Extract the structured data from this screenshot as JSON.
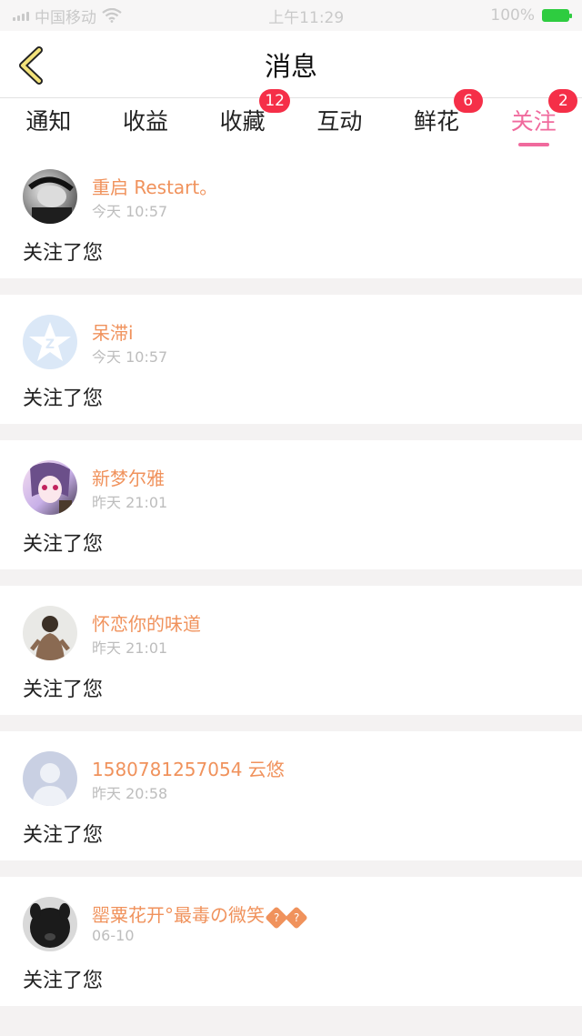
{
  "status_bar": {
    "carrier": "中国移动",
    "time": "上午11:29",
    "battery": "100%"
  },
  "header": {
    "title": "消息"
  },
  "tabs": [
    {
      "label": "通知",
      "badge": "",
      "active": false
    },
    {
      "label": "收益",
      "badge": "",
      "active": false
    },
    {
      "label": "收藏",
      "badge": "12",
      "active": false
    },
    {
      "label": "互动",
      "badge": "",
      "active": false
    },
    {
      "label": "鲜花",
      "badge": "6",
      "active": false
    },
    {
      "label": "关注",
      "badge": "2",
      "active": true
    }
  ],
  "colors": {
    "accent": "#f06a9d",
    "badge": "#f52f48",
    "name": "#f0925c"
  },
  "items": [
    {
      "name": "重启 Restart。",
      "time": "今天 10:57",
      "action": "关注了您",
      "avatar": "photo-avatar"
    },
    {
      "name": "呆滞i",
      "time": "今天 10:57",
      "action": "关注了您",
      "avatar": "default-qzone-avatar"
    },
    {
      "name": "新梦尔雅",
      "time": "昨天 21:01",
      "action": "关注了您",
      "avatar": "anime-avatar"
    },
    {
      "name": "怀恋你的味道",
      "time": "昨天 21:01",
      "action": "关注了您",
      "avatar": "photo-avatar"
    },
    {
      "name": "1580781257054 云悠",
      "time": "昨天 20:58",
      "action": "关注了您",
      "avatar": "default-person-avatar"
    },
    {
      "name": "罂粟花开°最毒の微笑",
      "time": "06-10",
      "action": "关注了您",
      "avatar": "animal-avatar"
    }
  ]
}
